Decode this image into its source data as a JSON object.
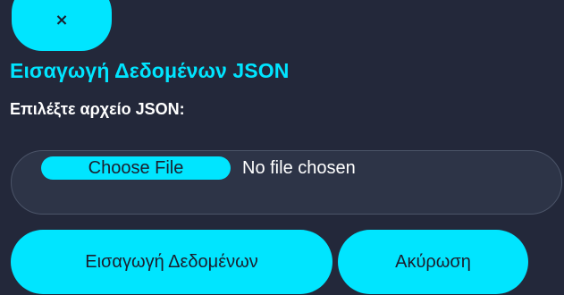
{
  "close_button": {
    "icon": "close-icon",
    "glyph": "×"
  },
  "dialog": {
    "title": "Εισαγωγή Δεδομένων JSON",
    "field_label": "Επιλέξτε αρχείο JSON:"
  },
  "file_input": {
    "button_label": "Choose File",
    "status": "No file chosen"
  },
  "actions": {
    "import_label": "Εισαγωγή Δεδομένων",
    "cancel_label": "Ακύρωση"
  },
  "colors": {
    "accent": "#00e5ff",
    "background": "#23283a",
    "input_background": "#2d3447"
  }
}
